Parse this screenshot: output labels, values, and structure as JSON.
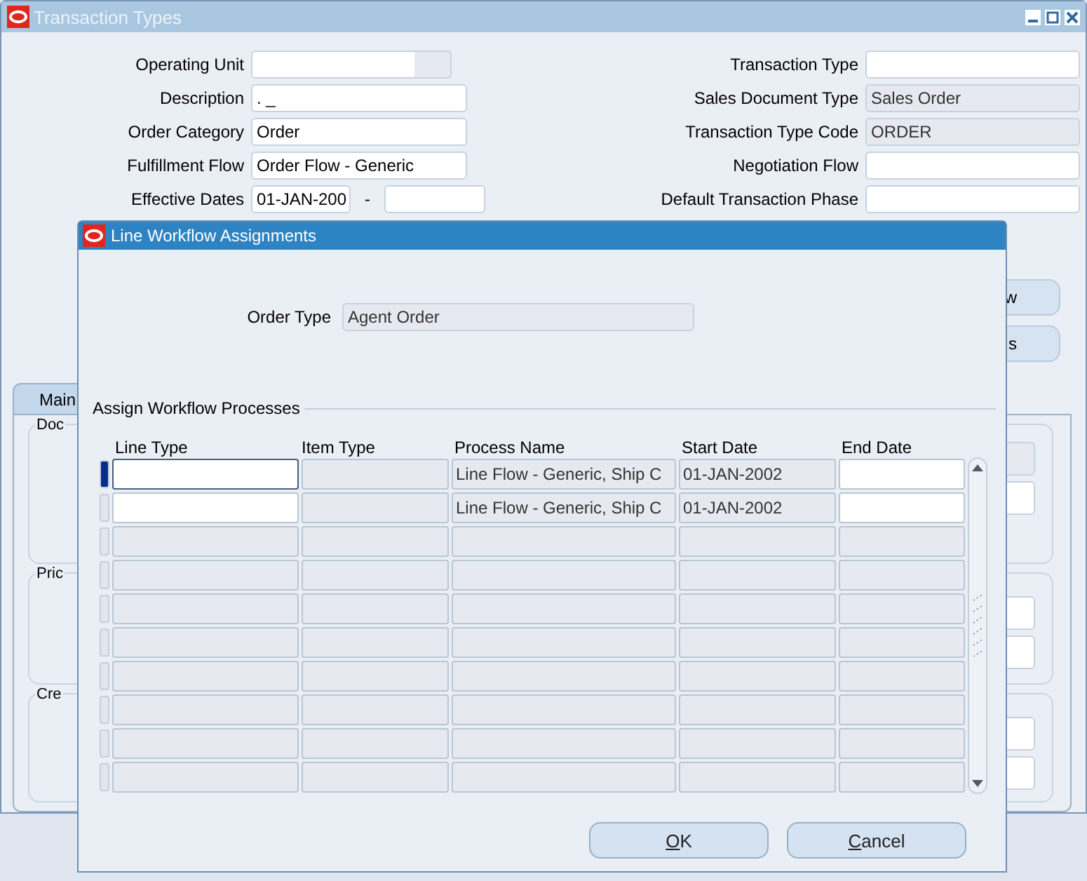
{
  "window": {
    "title": "Transaction Types"
  },
  "left_fields": [
    {
      "label": "Operating Unit",
      "kind": "lov"
    },
    {
      "label": "Description",
      "value": ". _",
      "kind": "text"
    },
    {
      "label": "Order Category",
      "value": "Order",
      "kind": "text"
    },
    {
      "label": "Fulfillment Flow",
      "value": "Order Flow - Generic",
      "kind": "text"
    },
    {
      "label": "Effective Dates",
      "value": "01-JAN-200",
      "kind": "range",
      "separator": "-"
    }
  ],
  "right_fields": [
    {
      "label": "Transaction Type",
      "disabled": false
    },
    {
      "label": "Sales Document Type",
      "value": "Sales Order",
      "disabled": true
    },
    {
      "label": "Transaction Type Code",
      "value": "ORDER",
      "disabled": true
    },
    {
      "label": "Negotiation Flow",
      "disabled": false
    },
    {
      "label": "Default Transaction Phase",
      "disabled": false
    }
  ],
  "side_buttons": [
    "w",
    "s"
  ],
  "tabs": [
    {
      "label": "Main",
      "selected": true
    }
  ],
  "groups": [
    {
      "label": "Doc"
    },
    {
      "label": "Pric"
    },
    {
      "label": "Cre"
    }
  ],
  "dialog": {
    "title": "Line Workflow Assignments",
    "order_type": {
      "label": "Order Type",
      "value": "Agent Order"
    },
    "section": "Assign Workflow Processes",
    "columns": [
      "Line Type",
      "Item Type",
      "Process Name",
      "Start Date",
      "End Date"
    ],
    "rows": [
      {
        "selected": true,
        "editable": true,
        "cells": [
          null,
          null,
          "Line Flow - Generic, Ship C",
          "01-JAN-2002",
          null
        ]
      },
      {
        "selected": false,
        "editable": true,
        "cells": [
          null,
          null,
          "Line Flow - Generic, Ship C",
          "01-JAN-2002",
          null
        ]
      },
      {
        "selected": false,
        "editable": false
      },
      {
        "selected": false,
        "editable": false
      },
      {
        "selected": false,
        "editable": false
      },
      {
        "selected": false,
        "editable": false
      },
      {
        "selected": false,
        "editable": false
      },
      {
        "selected": false,
        "editable": false
      },
      {
        "selected": false,
        "editable": false
      },
      {
        "selected": false,
        "editable": false
      }
    ],
    "buttons": [
      "OK",
      "Cancel"
    ]
  }
}
